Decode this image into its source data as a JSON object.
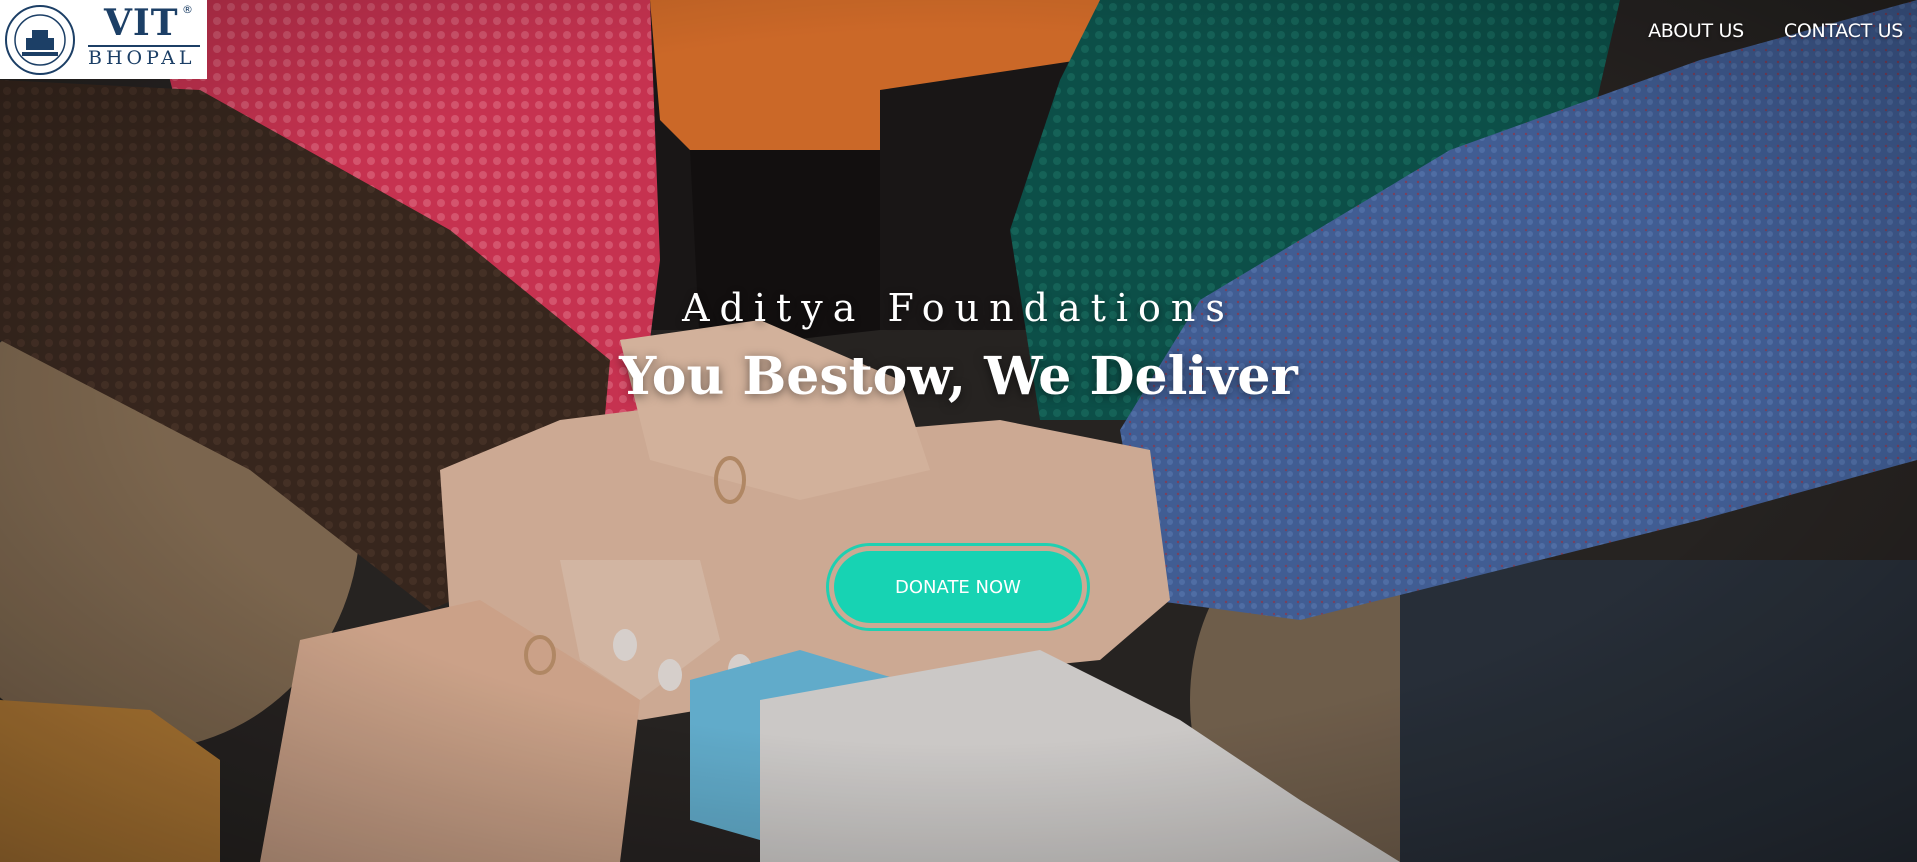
{
  "logo": {
    "name": "VIT",
    "registered_mark": "®",
    "campus": "BHOPAL"
  },
  "nav": {
    "items": [
      {
        "label": "ABOUT US"
      },
      {
        "label": "CONTACT US"
      }
    ]
  },
  "hero": {
    "org_name": "Aditya Foundations",
    "tagline": "You Bestow, We Deliver",
    "donate_label": "DONATE NOW",
    "accent_color": "#17d3b3",
    "background_image": "hands-stacked-together-photo"
  }
}
